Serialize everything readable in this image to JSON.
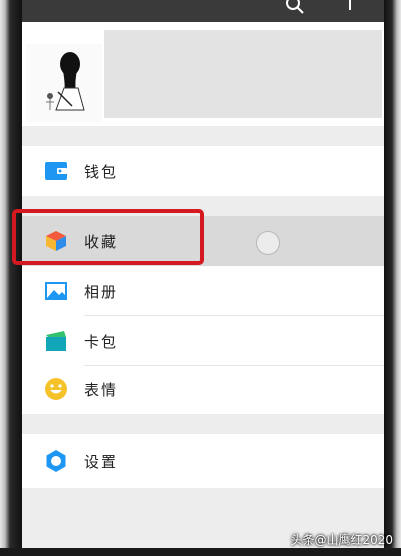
{
  "profile": {},
  "menu": {
    "wallet": {
      "label": "钱包",
      "icon": "wallet-icon",
      "color": "#1e97f2"
    },
    "favorites": {
      "label": "收藏",
      "icon": "cube-icon"
    },
    "album": {
      "label": "相册",
      "icon": "image-icon",
      "color": "#1e97f2"
    },
    "cards": {
      "label": "卡包",
      "icon": "card-icon",
      "color": "#11a7b8"
    },
    "stickers": {
      "label": "表情",
      "icon": "smiley-icon",
      "color": "#f6c22a"
    },
    "settings": {
      "label": "设置",
      "icon": "gear-icon",
      "color": "#1e97f2"
    }
  },
  "highlight_color": "#d41920",
  "watermark": "头条@山鹰红2020"
}
